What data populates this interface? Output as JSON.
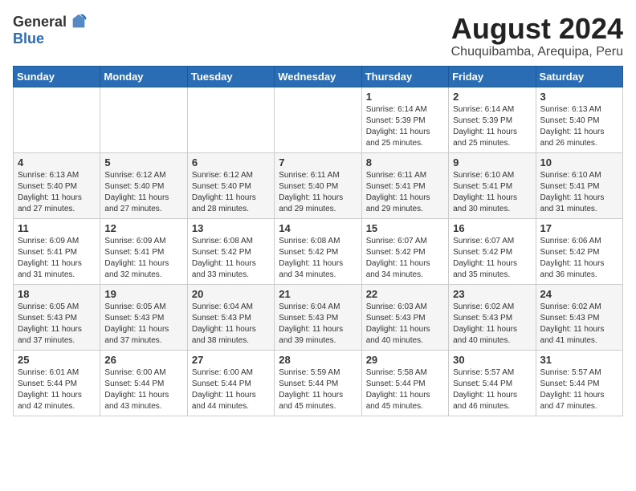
{
  "header": {
    "logo_general": "General",
    "logo_blue": "Blue",
    "title": "August 2024",
    "subtitle": "Chuquibamba, Arequipa, Peru"
  },
  "weekdays": [
    "Sunday",
    "Monday",
    "Tuesday",
    "Wednesday",
    "Thursday",
    "Friday",
    "Saturday"
  ],
  "weeks": [
    [
      {
        "day": "",
        "info": ""
      },
      {
        "day": "",
        "info": ""
      },
      {
        "day": "",
        "info": ""
      },
      {
        "day": "",
        "info": ""
      },
      {
        "day": "1",
        "info": "Sunrise: 6:14 AM\nSunset: 5:39 PM\nDaylight: 11 hours and 25 minutes."
      },
      {
        "day": "2",
        "info": "Sunrise: 6:14 AM\nSunset: 5:39 PM\nDaylight: 11 hours and 25 minutes."
      },
      {
        "day": "3",
        "info": "Sunrise: 6:13 AM\nSunset: 5:40 PM\nDaylight: 11 hours and 26 minutes."
      }
    ],
    [
      {
        "day": "4",
        "info": "Sunrise: 6:13 AM\nSunset: 5:40 PM\nDaylight: 11 hours and 27 minutes."
      },
      {
        "day": "5",
        "info": "Sunrise: 6:12 AM\nSunset: 5:40 PM\nDaylight: 11 hours and 27 minutes."
      },
      {
        "day": "6",
        "info": "Sunrise: 6:12 AM\nSunset: 5:40 PM\nDaylight: 11 hours and 28 minutes."
      },
      {
        "day": "7",
        "info": "Sunrise: 6:11 AM\nSunset: 5:40 PM\nDaylight: 11 hours and 29 minutes."
      },
      {
        "day": "8",
        "info": "Sunrise: 6:11 AM\nSunset: 5:41 PM\nDaylight: 11 hours and 29 minutes."
      },
      {
        "day": "9",
        "info": "Sunrise: 6:10 AM\nSunset: 5:41 PM\nDaylight: 11 hours and 30 minutes."
      },
      {
        "day": "10",
        "info": "Sunrise: 6:10 AM\nSunset: 5:41 PM\nDaylight: 11 hours and 31 minutes."
      }
    ],
    [
      {
        "day": "11",
        "info": "Sunrise: 6:09 AM\nSunset: 5:41 PM\nDaylight: 11 hours and 31 minutes."
      },
      {
        "day": "12",
        "info": "Sunrise: 6:09 AM\nSunset: 5:41 PM\nDaylight: 11 hours and 32 minutes."
      },
      {
        "day": "13",
        "info": "Sunrise: 6:08 AM\nSunset: 5:42 PM\nDaylight: 11 hours and 33 minutes."
      },
      {
        "day": "14",
        "info": "Sunrise: 6:08 AM\nSunset: 5:42 PM\nDaylight: 11 hours and 34 minutes."
      },
      {
        "day": "15",
        "info": "Sunrise: 6:07 AM\nSunset: 5:42 PM\nDaylight: 11 hours and 34 minutes."
      },
      {
        "day": "16",
        "info": "Sunrise: 6:07 AM\nSunset: 5:42 PM\nDaylight: 11 hours and 35 minutes."
      },
      {
        "day": "17",
        "info": "Sunrise: 6:06 AM\nSunset: 5:42 PM\nDaylight: 11 hours and 36 minutes."
      }
    ],
    [
      {
        "day": "18",
        "info": "Sunrise: 6:05 AM\nSunset: 5:43 PM\nDaylight: 11 hours and 37 minutes."
      },
      {
        "day": "19",
        "info": "Sunrise: 6:05 AM\nSunset: 5:43 PM\nDaylight: 11 hours and 37 minutes."
      },
      {
        "day": "20",
        "info": "Sunrise: 6:04 AM\nSunset: 5:43 PM\nDaylight: 11 hours and 38 minutes."
      },
      {
        "day": "21",
        "info": "Sunrise: 6:04 AM\nSunset: 5:43 PM\nDaylight: 11 hours and 39 minutes."
      },
      {
        "day": "22",
        "info": "Sunrise: 6:03 AM\nSunset: 5:43 PM\nDaylight: 11 hours and 40 minutes."
      },
      {
        "day": "23",
        "info": "Sunrise: 6:02 AM\nSunset: 5:43 PM\nDaylight: 11 hours and 40 minutes."
      },
      {
        "day": "24",
        "info": "Sunrise: 6:02 AM\nSunset: 5:43 PM\nDaylight: 11 hours and 41 minutes."
      }
    ],
    [
      {
        "day": "25",
        "info": "Sunrise: 6:01 AM\nSunset: 5:44 PM\nDaylight: 11 hours and 42 minutes."
      },
      {
        "day": "26",
        "info": "Sunrise: 6:00 AM\nSunset: 5:44 PM\nDaylight: 11 hours and 43 minutes."
      },
      {
        "day": "27",
        "info": "Sunrise: 6:00 AM\nSunset: 5:44 PM\nDaylight: 11 hours and 44 minutes."
      },
      {
        "day": "28",
        "info": "Sunrise: 5:59 AM\nSunset: 5:44 PM\nDaylight: 11 hours and 45 minutes."
      },
      {
        "day": "29",
        "info": "Sunrise: 5:58 AM\nSunset: 5:44 PM\nDaylight: 11 hours and 45 minutes."
      },
      {
        "day": "30",
        "info": "Sunrise: 5:57 AM\nSunset: 5:44 PM\nDaylight: 11 hours and 46 minutes."
      },
      {
        "day": "31",
        "info": "Sunrise: 5:57 AM\nSunset: 5:44 PM\nDaylight: 11 hours and 47 minutes."
      }
    ]
  ]
}
